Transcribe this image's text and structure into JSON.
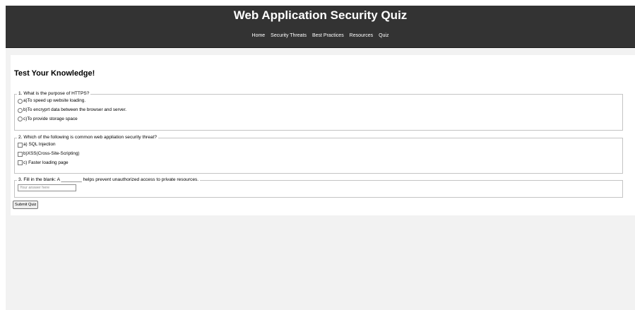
{
  "header": {
    "title": "Web Application Security Quiz",
    "nav": [
      "Home",
      "Security Threats",
      "Best Practices",
      "Resources",
      "Quiz"
    ]
  },
  "quiz": {
    "heading": "Test Your Knowledge!",
    "questions": [
      {
        "legend": "1. What is the purpose of HTTPS?",
        "type": "radio",
        "options": [
          "a)To speed up website loading.",
          "b)To encryprt data between the browser and server.",
          "c)To provide storage space"
        ]
      },
      {
        "legend": "2. Which of the following is common web appliation security threat?",
        "type": "checkbox",
        "options": [
          "a) SQL Injection",
          "b)XSS(Cross-Site-Scripting)",
          "c) Faster loading page"
        ]
      },
      {
        "legend": "3. Fill in the blank: A ________ helps prevent unauthorized access to private resources.",
        "type": "text",
        "placeholder": "Your answer here",
        "value": ""
      }
    ],
    "submit_label": "Submit Quiz"
  },
  "colors": {
    "header_bg": "#333333",
    "page_bg": "#f2f2f2",
    "card_bg": "#ffffff"
  }
}
